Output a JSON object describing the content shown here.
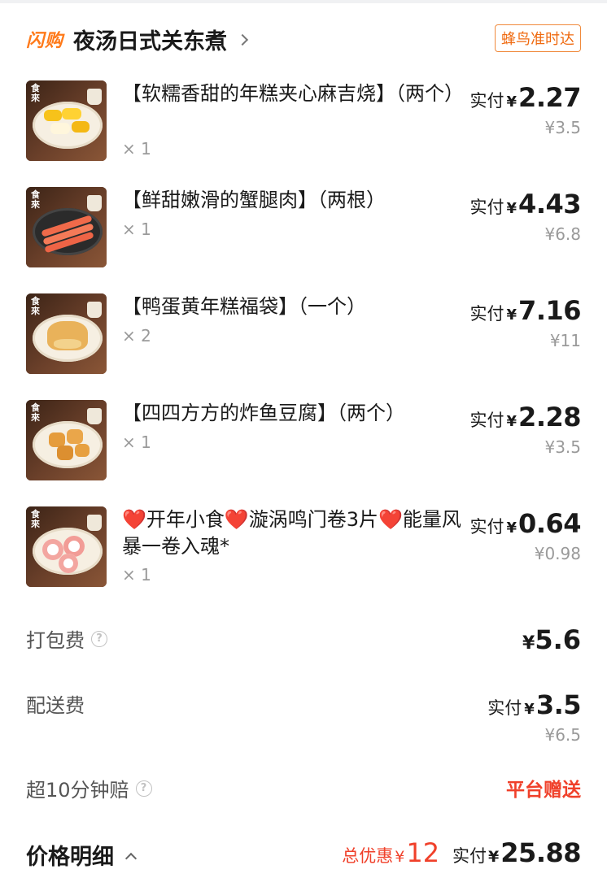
{
  "header": {
    "brand": "闪购",
    "store_name": "夜汤日式关东煮",
    "delivery_badge": "蜂鸟准时达"
  },
  "items": [
    {
      "name": "【软糯香甜的年糕夹心麻吉烧】（两个）",
      "qty": "× 1",
      "paid_label": "实付",
      "yen": "¥",
      "paid_amount": "2.27",
      "original_price": "¥3.5",
      "image": "mochi-cheese-cakes"
    },
    {
      "name": "【鲜甜嫩滑的蟹腿肉】（两根）",
      "qty": "× 1",
      "paid_label": "实付",
      "yen": "¥",
      "paid_amount": "4.43",
      "original_price": "¥6.8",
      "image": "crab-sticks"
    },
    {
      "name": "【鸭蛋黄年糕福袋】（一个）",
      "qty": "× 2",
      "paid_label": "实付",
      "yen": "¥",
      "paid_amount": "7.16",
      "original_price": "¥11",
      "image": "tofu-pouch"
    },
    {
      "name": "【四四方方的炸鱼豆腐】（两个）",
      "qty": "× 1",
      "paid_label": "实付",
      "yen": "¥",
      "paid_amount": "2.28",
      "original_price": "¥3.5",
      "image": "fried-fish-tofu"
    },
    {
      "name": "❤️开年小食❤️漩涡鸣门卷3片❤️能量风暴一卷入魂*",
      "qty": "× 1",
      "paid_label": "实付",
      "yen": "¥",
      "paid_amount": "0.64",
      "original_price": "¥0.98",
      "image": "naruto-fish-cake"
    }
  ],
  "fees": {
    "packing": {
      "label": "打包费",
      "yen": "¥",
      "amount": "5.6"
    },
    "delivery": {
      "label": "配送费",
      "paid_label": "实付",
      "yen": "¥",
      "amount": "3.5",
      "original_price": "¥6.5"
    },
    "late_compensation": {
      "label": "超10分钟赔",
      "value": "平台赠送"
    }
  },
  "summary": {
    "title": "价格明细",
    "discount_label": "总优惠",
    "discount_yen": "¥",
    "discount_amount": "12",
    "total_label": "实付",
    "total_yen": "¥",
    "total_amount": "25.88"
  },
  "colors": {
    "brand": "#ff7a1a",
    "badge": "#ef6a10",
    "discount": "#f0402a"
  },
  "icons": {
    "help": "help-circle-icon",
    "chevron_right": "chevron-right-icon",
    "chevron_up": "chevron-up-icon"
  }
}
